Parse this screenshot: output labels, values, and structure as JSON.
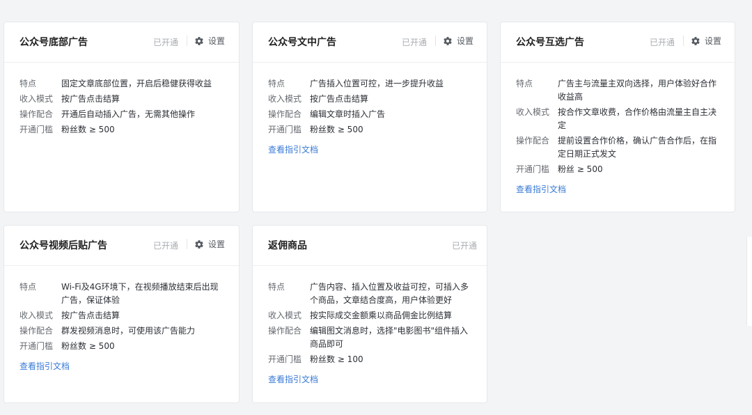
{
  "cards": [
    {
      "title": "公众号底部广告",
      "status": "已开通",
      "settings_label": "设置",
      "rows": [
        {
          "label": "特点",
          "value": "固定文章底部位置，开启后稳健获得收益"
        },
        {
          "label": "收入模式",
          "value": "按广告点击结算"
        },
        {
          "label": "操作配合",
          "value": "开通后自动插入广告，无需其他操作"
        },
        {
          "label": "开通门槛",
          "value": "粉丝数 ≥ 500"
        }
      ]
    },
    {
      "title": "公众号文中广告",
      "status": "已开通",
      "settings_label": "设置",
      "rows": [
        {
          "label": "特点",
          "value": "广告插入位置可控，进一步提升收益"
        },
        {
          "label": "收入模式",
          "value": "按广告点击结算"
        },
        {
          "label": "操作配合",
          "value": "编辑文章时插入广告"
        },
        {
          "label": "开通门槛",
          "value": "粉丝数 ≥ 500"
        }
      ],
      "doc_link": "查看指引文档"
    },
    {
      "title": "公众号互选广告",
      "status": "已开通",
      "settings_label": "设置",
      "rows": [
        {
          "label": "特点",
          "value": "广告主与流量主双向选择，用户体验好合作收益高"
        },
        {
          "label": "收入模式",
          "value": "按合作文章收费，合作价格由流量主自主决定"
        },
        {
          "label": "操作配合",
          "value": "提前设置合作价格，确认广告合作后，在指定日期正式发文"
        },
        {
          "label": "开通门槛",
          "value": "粉丝 ≥ 500"
        }
      ],
      "doc_link": "查看指引文档"
    },
    {
      "title": "公众号视频后贴广告",
      "status": "已开通",
      "settings_label": "设置",
      "rows": [
        {
          "label": "特点",
          "value": "Wi-Fi及4G环境下，在视频播放结束后出现广告，保证体验"
        },
        {
          "label": "收入模式",
          "value": "按广告点击结算"
        },
        {
          "label": "操作配合",
          "value": "群发视频消息时，可使用该广告能力"
        },
        {
          "label": "开通门槛",
          "value": "粉丝数 ≥ 500"
        }
      ],
      "doc_link": "查看指引文档"
    },
    {
      "title": "返佣商品",
      "status": "已开通",
      "rows": [
        {
          "label": "特点",
          "value": "广告内容、插入位置及收益可控，可插入多个商品，文章结合度高，用户体验更好"
        },
        {
          "label": "收入模式",
          "value": "按实际成交金额乘以商品佣金比例结算"
        },
        {
          "label": "操作配合",
          "value": "编辑图文消息时，选择\"电影图书\"组件插入商品即可"
        },
        {
          "label": "开通门槛",
          "value": "粉丝数 ≥ 100"
        }
      ],
      "doc_link": "查看指引文档"
    }
  ],
  "icons": {
    "settings": "gear-icon"
  },
  "colors": {
    "background": "#f3f4f6",
    "link": "#3a7bd5",
    "status": "#a8acb2"
  }
}
